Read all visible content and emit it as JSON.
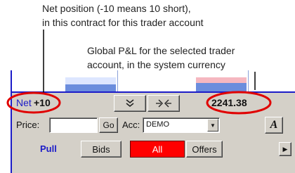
{
  "callouts": {
    "net_position": [
      "Net position (-10 means 10 short),",
      "in this contract for this trader account"
    ],
    "global_pnl": [
      "Global P&L for the selected trader",
      "account, in the system currency"
    ]
  },
  "toolbar": {
    "net_label": "Net",
    "net_value": "+10",
    "down_button_icon": "double-chevron-down-icon",
    "flatten_button_icon": "flatten-arrows-icon",
    "pnl_value": "2241.38"
  },
  "order_entry": {
    "price_label": "Price:",
    "price_value": "",
    "go_label": "Go",
    "account_label": "Acc:",
    "account_value": "DEMO",
    "font_button_label": "A"
  },
  "filters": {
    "pull_label": "Pull",
    "bids_label": "Bids",
    "all_label": "All",
    "offers_label": "Offers"
  },
  "colors": {
    "accent_blue": "#1c1cc8",
    "all_button": "#ff0000",
    "annotation_ellipse": "#e00000",
    "panel": "#d4d0c8"
  }
}
